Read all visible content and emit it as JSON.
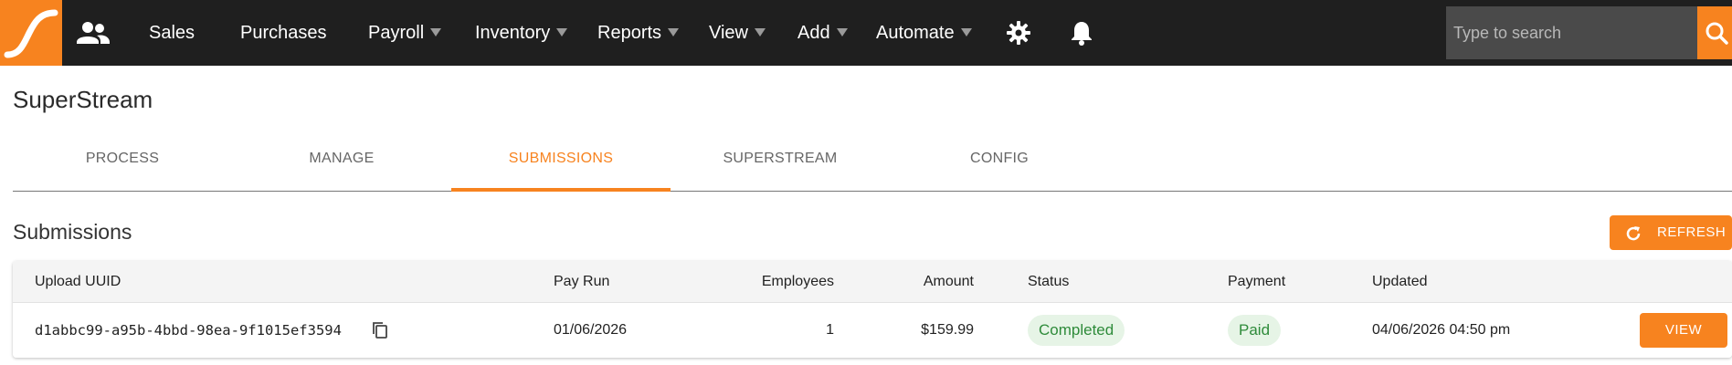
{
  "colors": {
    "accent": "#f7831f",
    "navbar_bg": "#1f1f1f",
    "status_green": "#2e8b3a",
    "badge_bg": "#e6f4e6"
  },
  "navbar": {
    "logo": "superstream-logo",
    "contacts_icon": "people-icon",
    "items": [
      {
        "label": "Sales",
        "has_dropdown": false
      },
      {
        "label": "Purchases",
        "has_dropdown": false
      },
      {
        "label": "Payroll",
        "has_dropdown": true
      },
      {
        "label": "Inventory",
        "has_dropdown": true
      },
      {
        "label": "Reports",
        "has_dropdown": true
      },
      {
        "label": "View",
        "has_dropdown": true
      },
      {
        "label": "Add",
        "has_dropdown": true
      },
      {
        "label": "Automate",
        "has_dropdown": true
      }
    ],
    "settings_icon": "gear-icon",
    "notifications_icon": "bell-icon",
    "search": {
      "placeholder": "Type to search",
      "value": ""
    },
    "search_icon": "search-icon"
  },
  "page": {
    "title": "SuperStream",
    "tabs": [
      {
        "label": "PROCESS",
        "active": false
      },
      {
        "label": "MANAGE",
        "active": false
      },
      {
        "label": "SUBMISSIONS",
        "active": true
      },
      {
        "label": "SUPERSTREAM",
        "active": false
      },
      {
        "label": "CONFIG",
        "active": false
      }
    ]
  },
  "submissions": {
    "title": "Submissions",
    "refresh_label": "REFRESH",
    "columns": [
      "Upload UUID",
      "Pay Run",
      "Employees",
      "Amount",
      "Status",
      "Payment",
      "Updated"
    ],
    "rows": [
      {
        "uuid": "d1abbc99-a95b-4bbd-98ea-9f1015ef3594",
        "pay_run": "01/06/2026",
        "employees": "1",
        "amount": "$159.99",
        "status": "Completed",
        "payment": "Paid",
        "updated": "04/06/2026 04:50 pm",
        "action_label": "VIEW"
      }
    ]
  }
}
